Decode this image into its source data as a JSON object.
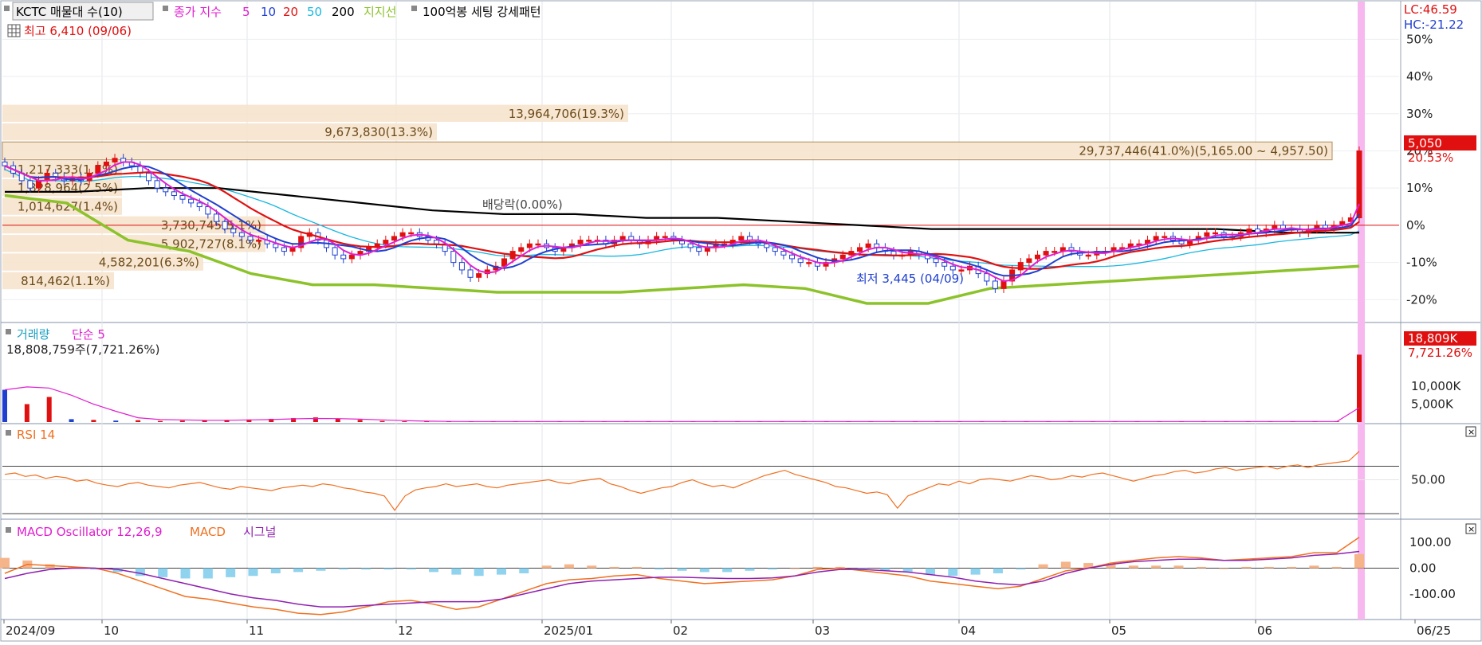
{
  "header": {
    "symbol_label": "KCTC 매물대 수(10)",
    "ma_label": "종가 지수",
    "ma_periods": [
      {
        "label": "5",
        "color": "#e01fd0"
      },
      {
        "label": "10",
        "color": "#1f3fd0"
      },
      {
        "label": "20",
        "color": "#e01010"
      },
      {
        "label": "50",
        "color": "#19b7e0"
      },
      {
        "label": "200",
        "color": "#000000"
      }
    ],
    "support_label": "지지선",
    "pattern_label": "100억봉 세팅 강세패턴",
    "high_label": "최고 6,410 (09/06)",
    "lc_label": "LC:46.59",
    "hc_label": "HC:-21.22"
  },
  "chart_data": [
    {
      "type": "candlestick",
      "title": "KCTC 매물대 수(10)",
      "y_axis_unit": "%",
      "y_ticks": [
        "50%",
        "40%",
        "30%",
        "20%",
        "10%",
        "0%",
        "-10%",
        "-20%"
      ],
      "ylim": [
        -24,
        52
      ],
      "x_ticks": [
        "2024/09",
        "10",
        "11",
        "12",
        "2025/01",
        "02",
        "03",
        "04",
        "05",
        "06",
        "06/25"
      ],
      "last_price": "5,050",
      "last_change": "20.53%",
      "dividend_note": "배당락(0.00%)",
      "low_note": "최저 3,445 (04/09)",
      "close_pct": [
        16,
        14,
        12,
        10,
        12,
        14,
        13,
        12,
        13,
        12,
        14,
        16,
        17,
        18,
        17,
        16,
        14,
        12,
        10,
        9,
        8,
        7,
        6,
        5,
        3,
        1,
        -1,
        -2,
        -3,
        -4,
        -4,
        -5,
        -6,
        -7,
        -6,
        -3,
        -2,
        -4,
        -6,
        -8,
        -9,
        -8,
        -7,
        -6,
        -5,
        -4,
        -3,
        -2,
        -2,
        -3,
        -4,
        -5,
        -7,
        -10,
        -12,
        -14,
        -13,
        -12,
        -11,
        -9,
        -7,
        -6,
        -5,
        -5,
        -6,
        -7,
        -6,
        -5,
        -4,
        -4,
        -4,
        -5,
        -4,
        -3,
        -4,
        -5,
        -4,
        -3,
        -3,
        -4,
        -5,
        -6,
        -7,
        -6,
        -5,
        -5,
        -4,
        -3,
        -4,
        -5,
        -6,
        -7,
        -8,
        -9,
        -10,
        -10,
        -11,
        -10,
        -9,
        -8,
        -7,
        -6,
        -5,
        -6,
        -7,
        -8,
        -8,
        -7,
        -8,
        -9,
        -10,
        -11,
        -12,
        -12,
        -11,
        -13,
        -15,
        -17,
        -15,
        -12,
        -10,
        -9,
        -8,
        -7,
        -7,
        -6,
        -7,
        -8,
        -8,
        -7,
        -7,
        -6,
        -6,
        -5,
        -5,
        -4,
        -3,
        -3,
        -4,
        -5,
        -4,
        -3,
        -2,
        -2,
        -3,
        -3,
        -2,
        -1,
        -2,
        -1,
        0,
        -1,
        -1,
        -2,
        -1,
        0,
        -1,
        0,
        1,
        2,
        20
      ],
      "ma200_pct": [
        9,
        9,
        10,
        10,
        8,
        6,
        4,
        3,
        3,
        2,
        2,
        1,
        0,
        -1,
        -1,
        -1,
        -1,
        -1,
        -2,
        -2
      ],
      "support_pct": [
        8,
        6,
        -4,
        -7,
        -13,
        -16,
        -16,
        -17,
        -18,
        -18,
        -18,
        -17,
        -16,
        -17,
        -21,
        -21,
        -17,
        -16,
        -15,
        -14,
        -13,
        -12,
        -11
      ],
      "volume_profile": [
        {
          "label": "13,964,706(19.3%)",
          "price_pct": 30
        },
        {
          "label": "9,673,830(13.3%)",
          "price_pct": 25
        },
        {
          "label": "29,737,446(41.0%)(5,165.00 ~ 4,957.50)",
          "price_pct": 20
        },
        {
          "label": "1,217,333(1.7%)",
          "price_pct": 15
        },
        {
          "label": "1,828,964(2.5%)",
          "price_pct": 10
        },
        {
          "label": "1,014,627(1.4%)",
          "price_pct": 5
        },
        {
          "label": "3,730,745(5.1%)",
          "price_pct": 0
        },
        {
          "label": "5,902,727(8.1%)",
          "price_pct": -5
        },
        {
          "label": "4,582,201(6.3%)",
          "price_pct": -10
        },
        {
          "label": "814,462(1.1%)",
          "price_pct": -15
        }
      ]
    },
    {
      "type": "bar",
      "title": "거래량",
      "ma_label": "단순 5",
      "summary": "18,808,759주(7,721.26%)",
      "y_ticks": [
        "10,000K",
        "5,000K"
      ],
      "last_value_label": "18,809K",
      "last_change_label": "7,721.26%",
      "ylim": [
        0,
        20000
      ],
      "values_k": [
        9000,
        5000,
        7000,
        800,
        600,
        400,
        500,
        300,
        400,
        500,
        600,
        700,
        900,
        1100,
        1300,
        1000,
        600,
        300,
        200,
        150,
        150,
        150,
        150,
        150,
        150,
        150,
        150,
        150,
        150,
        150,
        150,
        150,
        150,
        150,
        150,
        150,
        150,
        150,
        150,
        150,
        150,
        150,
        150,
        150,
        150,
        150,
        150,
        150,
        150,
        150,
        150,
        150,
        150,
        150,
        150,
        150,
        150,
        150,
        150,
        150,
        150,
        18809
      ],
      "ma_k": [
        9000,
        9800,
        9500,
        7500,
        5000,
        3000,
        1200,
        700,
        600,
        500,
        500,
        600,
        700,
        900,
        1000,
        950,
        800,
        600,
        400,
        250,
        180,
        150,
        150,
        150,
        150,
        150,
        150,
        150,
        150,
        150,
        150,
        150,
        150,
        150,
        150,
        150,
        150,
        150,
        150,
        150,
        150,
        150,
        150,
        150,
        150,
        150,
        150,
        150,
        150,
        150,
        150,
        150,
        150,
        150,
        150,
        150,
        150,
        150,
        150,
        150,
        150,
        4000
      ]
    },
    {
      "type": "line",
      "title": "RSI 14",
      "y_ticks": [
        "50.00"
      ],
      "ylim": [
        0,
        100
      ],
      "values": [
        58,
        60,
        55,
        57,
        52,
        55,
        53,
        48,
        50,
        45,
        42,
        40,
        44,
        46,
        42,
        40,
        38,
        42,
        44,
        46,
        42,
        38,
        36,
        40,
        38,
        36,
        34,
        38,
        40,
        42,
        40,
        44,
        42,
        38,
        36,
        32,
        30,
        26,
        5,
        26,
        35,
        38,
        40,
        44,
        40,
        42,
        44,
        40,
        38,
        42,
        44,
        46,
        48,
        50,
        46,
        44,
        48,
        50,
        52,
        44,
        40,
        34,
        30,
        34,
        38,
        40,
        46,
        50,
        44,
        40,
        42,
        38,
        44,
        50,
        56,
        60,
        64,
        58,
        54,
        50,
        46,
        40,
        38,
        34,
        30,
        32,
        28,
        8,
        26,
        32,
        38,
        44,
        42,
        48,
        44,
        50,
        52,
        50,
        48,
        52,
        56,
        54,
        50,
        52,
        56,
        54,
        58,
        60,
        56,
        52,
        48,
        52,
        56,
        58,
        62,
        64,
        60,
        62,
        66,
        68,
        64,
        66,
        68,
        70,
        66,
        70,
        72,
        68,
        72,
        74,
        76,
        78,
        92
      ]
    },
    {
      "type": "line",
      "title": "MACD Oscillator 12,26,9",
      "y_ticks": [
        "100.00",
        "0.00",
        "-100.00"
      ],
      "ylim": [
        -190,
        150
      ],
      "series": [
        {
          "name": "MACD",
          "color": "#f07020",
          "values": [
            -20,
            15,
            10,
            5,
            0,
            -20,
            -50,
            -80,
            -110,
            -120,
            -135,
            -150,
            -160,
            -175,
            -180,
            -170,
            -150,
            -130,
            -125,
            -140,
            -160,
            -150,
            -120,
            -90,
            -60,
            -45,
            -40,
            -30,
            -25,
            -40,
            -50,
            -60,
            -55,
            -50,
            -45,
            -30,
            -5,
            0,
            -10,
            -20,
            -30,
            -50,
            -60,
            -70,
            -80,
            -70,
            -40,
            -10,
            0,
            20,
            30,
            40,
            45,
            40,
            30,
            35,
            40,
            45,
            60,
            60,
            120
          ]
        },
        {
          "name": "시그널",
          "color": "#9020b0",
          "values": [
            -40,
            -20,
            -5,
            0,
            0,
            -5,
            -20,
            -40,
            -60,
            -80,
            -100,
            -115,
            -125,
            -140,
            -150,
            -150,
            -145,
            -140,
            -135,
            -130,
            -130,
            -130,
            -120,
            -100,
            -80,
            -60,
            -50,
            -45,
            -40,
            -35,
            -35,
            -38,
            -40,
            -40,
            -38,
            -30,
            -15,
            -5,
            -5,
            -10,
            -15,
            -25,
            -35,
            -50,
            -60,
            -65,
            -50,
            -20,
            0,
            15,
            25,
            30,
            35,
            35,
            30,
            30,
            35,
            40,
            50,
            55,
            65
          ]
        }
      ],
      "oscillator_values": [
        40,
        30,
        15,
        5,
        -5,
        -15,
        -30,
        -35,
        -40,
        -40,
        -35,
        -30,
        -20,
        -15,
        -10,
        -5,
        -5,
        -5,
        -5,
        -15,
        -25,
        -30,
        -25,
        -20,
        10,
        15,
        10,
        5,
        5,
        -5,
        -10,
        -15,
        -15,
        -10,
        -5,
        0,
        5,
        5,
        -5,
        -10,
        -15,
        -25,
        -30,
        -25,
        -20,
        -5,
        15,
        25,
        20,
        15,
        10,
        10,
        10,
        5,
        0,
        5,
        5,
        5,
        10,
        5,
        55
      ]
    }
  ]
}
